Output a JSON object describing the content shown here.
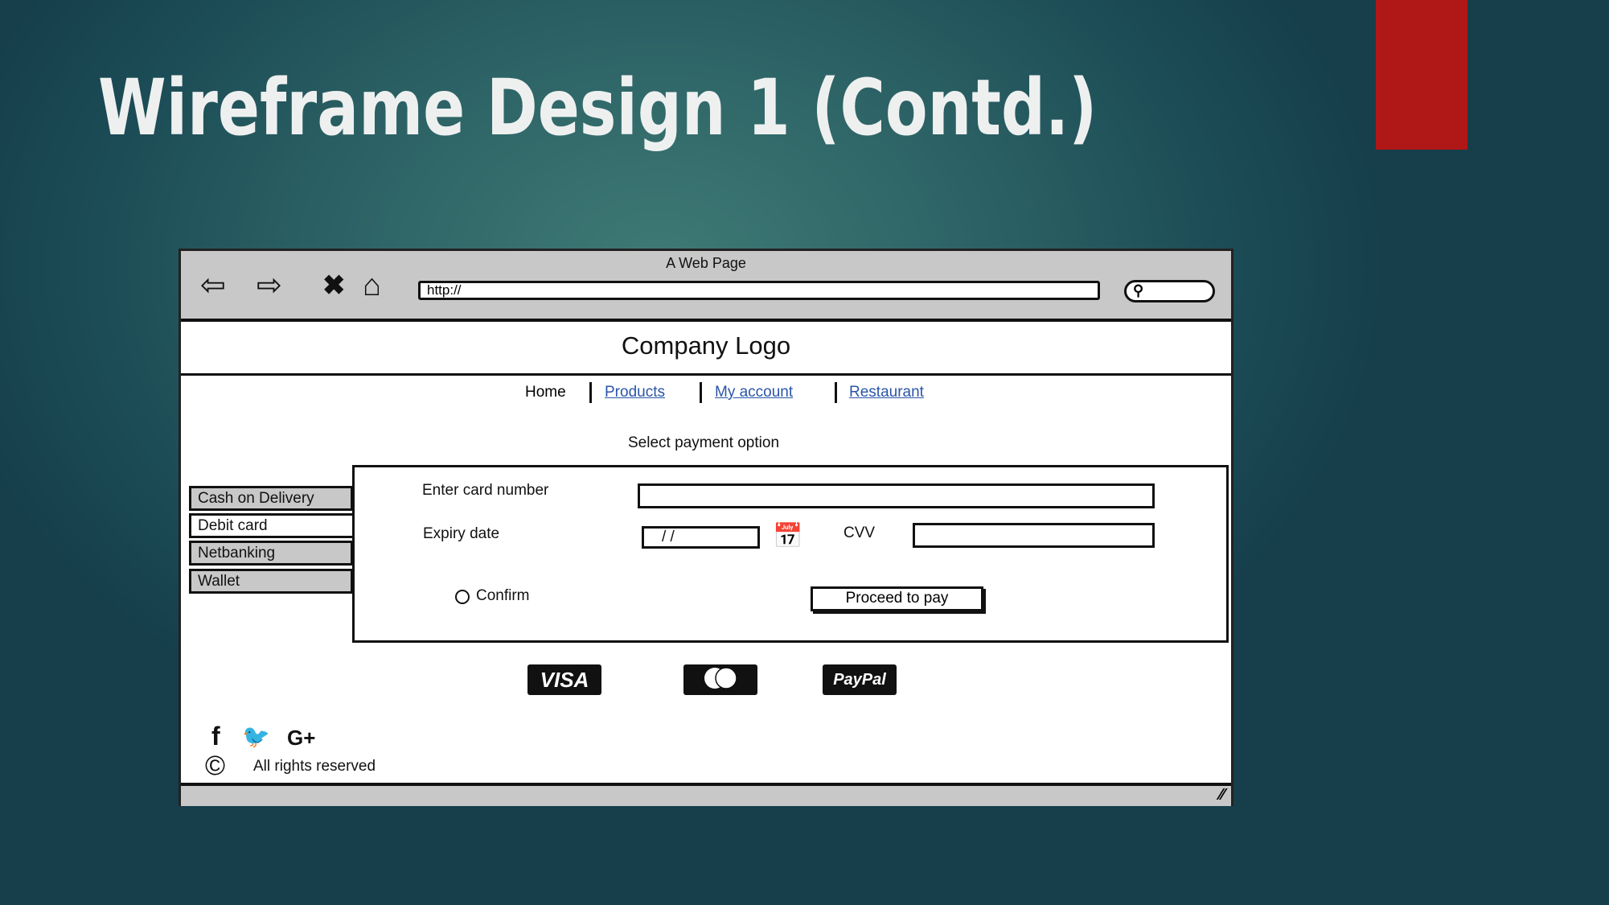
{
  "slide": {
    "title": "Wireframe Design 1 (Contd.)",
    "accent_color": "#b01717"
  },
  "browser": {
    "window_title": "A Web Page",
    "url": "http://",
    "icons": [
      "back-arrow-icon",
      "forward-arrow-icon",
      "close-icon",
      "home-icon",
      "search-icon"
    ]
  },
  "page": {
    "logo": "Company Logo",
    "nav": [
      {
        "label": "Home"
      },
      {
        "label": "Products"
      },
      {
        "label": "My account"
      },
      {
        "label": "Restaurant"
      }
    ],
    "select_label": "Select payment option",
    "tabs": [
      {
        "label": "Cash on Delivery"
      },
      {
        "label": "Debit card"
      },
      {
        "label": "Netbanking"
      },
      {
        "label": "Wallet"
      }
    ],
    "form": {
      "card_number_label": "Enter card number",
      "expiry_label": "Expiry date",
      "expiry_value": "/ /",
      "cvv_label": "CVV",
      "confirm_label": "Confirm",
      "proceed_label": "Proceed to pay"
    },
    "payment_logos": {
      "visa": "VISA",
      "mastercard": "mastercard",
      "paypal": "PayPal"
    },
    "social": {
      "facebook": "f",
      "google": "G+"
    },
    "footer": {
      "copyright_symbol": "©",
      "text": "All rights reserved"
    }
  }
}
